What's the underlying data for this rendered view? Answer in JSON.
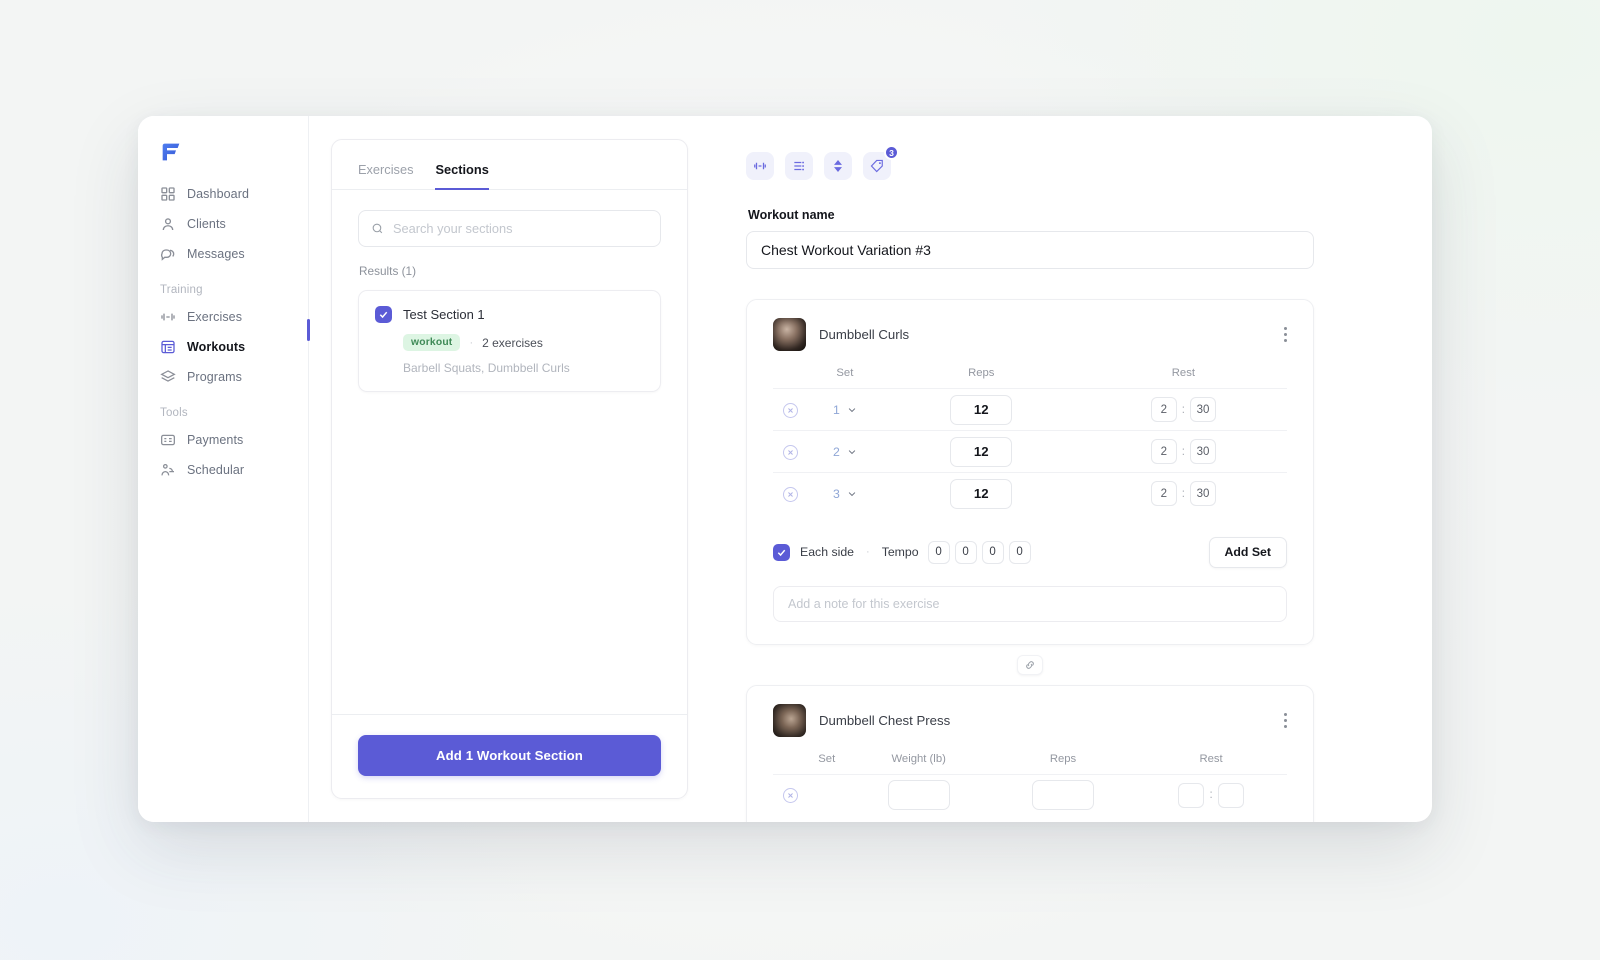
{
  "app": {
    "logo_name": "fitness-app-logo",
    "accent_color": "#5b5bd6",
    "badge_color": "#5b5bd6",
    "pill_color": "#ddf5e3"
  },
  "sidebar": {
    "items": [
      {
        "label": "Dashboard",
        "icon": "grid-icon",
        "active": false
      },
      {
        "label": "Clients",
        "icon": "user-icon",
        "active": false
      },
      {
        "label": "Messages",
        "icon": "chat-icon",
        "active": false
      }
    ],
    "groups": [
      {
        "label": "Training",
        "items": [
          {
            "label": "Exercises",
            "icon": "dumbbell-icon",
            "active": false
          },
          {
            "label": "Workouts",
            "icon": "workout-list-icon",
            "active": true
          },
          {
            "label": "Programs",
            "icon": "layers-icon",
            "active": false
          }
        ]
      },
      {
        "label": "Tools",
        "items": [
          {
            "label": "Payments",
            "icon": "card-icon",
            "active": false
          },
          {
            "label": "Schedular",
            "icon": "schedule-icon",
            "active": false
          }
        ]
      }
    ]
  },
  "sections_panel": {
    "tabs": [
      {
        "label": "Exercises",
        "active": false
      },
      {
        "label": "Sections",
        "active": true
      }
    ],
    "search": {
      "value": "",
      "placeholder": "Search your sections"
    },
    "results_label": "Results (1)",
    "cards": [
      {
        "title": "Test Section 1",
        "checked": true,
        "tag": "workout",
        "count": "2 exercises",
        "exercises": "Barbell Squats, Dumbbell Curls"
      }
    ],
    "add_button": "Add 1 Workout Section"
  },
  "editor": {
    "toolbar": [
      {
        "icon": "dumbbell-icon",
        "badge": ""
      },
      {
        "icon": "list-settings-icon",
        "badge": ""
      },
      {
        "icon": "sort-updown-icon",
        "badge": ""
      },
      {
        "icon": "tag-icon",
        "badge": "3"
      }
    ],
    "workout_name": {
      "label": "Workout name",
      "value": "Chest Workout Variation #3",
      "placeholder": "Workout name"
    },
    "link_icon": "link-icon",
    "exercises": [
      {
        "name": "Dumbbell Curls",
        "thumbnail": "exercise-photo-thumbnail",
        "columns": [
          "Set",
          "Reps",
          "Rest"
        ],
        "sets": [
          {
            "set": "1",
            "reps": "12",
            "rest_min": "2",
            "rest_sec": "30"
          },
          {
            "set": "2",
            "reps": "12",
            "rest_min": "2",
            "rest_sec": "30"
          },
          {
            "set": "3",
            "reps": "12",
            "rest_min": "2",
            "rest_sec": "30"
          }
        ],
        "each_side": {
          "label": "Each side",
          "checked": true
        },
        "tempo": {
          "label": "Tempo",
          "values": [
            "0",
            "0",
            "0",
            "0"
          ]
        },
        "add_set_label": "Add Set",
        "note": {
          "value": "",
          "placeholder": "Add a note for this exercise"
        }
      },
      {
        "name": "Dumbbell Chest Press",
        "thumbnail": "exercise-photo-thumbnail",
        "columns": [
          "Set",
          "Weight (lb)",
          "Reps",
          "Rest"
        ],
        "sets": []
      }
    ]
  }
}
